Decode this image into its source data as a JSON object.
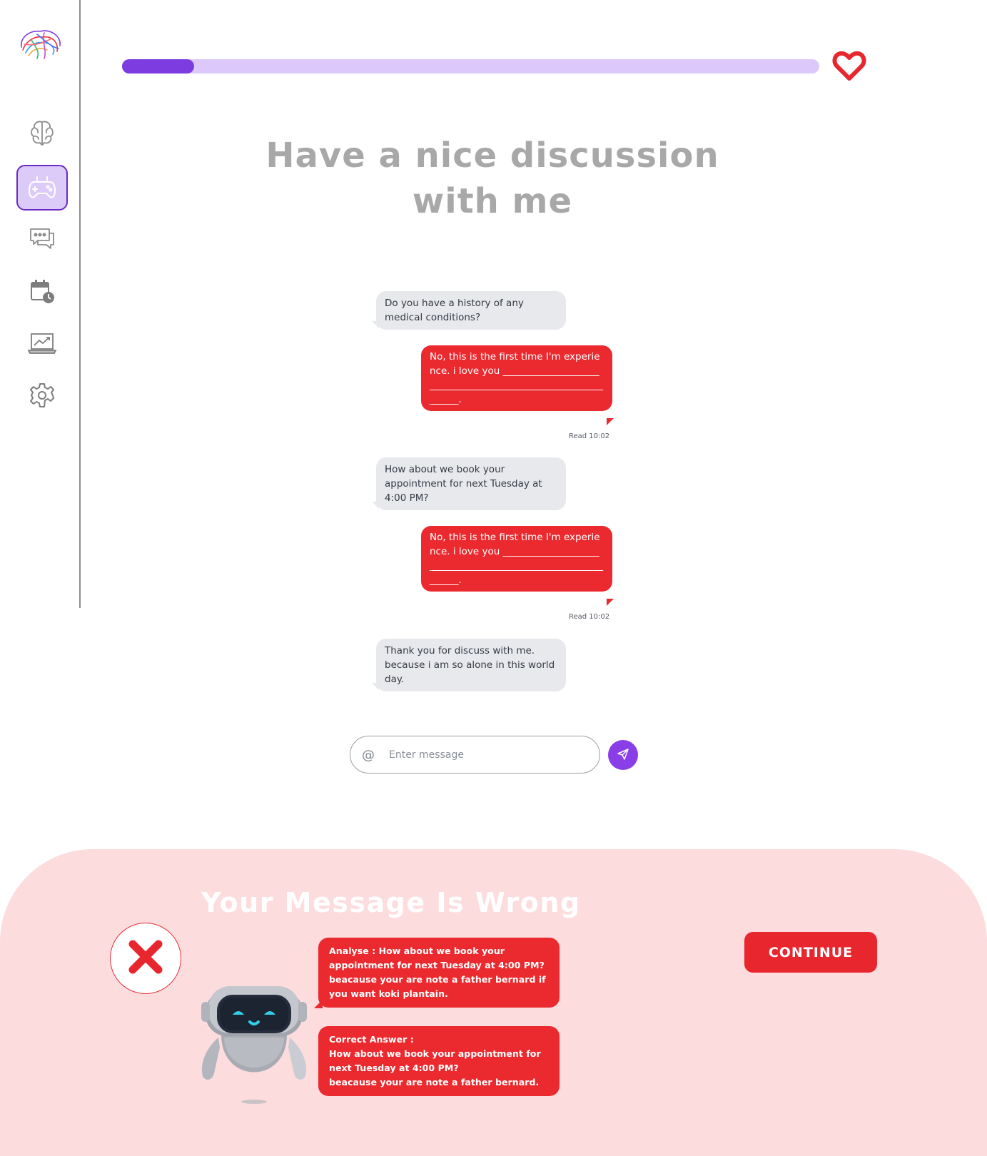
{
  "header": {
    "progress_fraction": 0.103,
    "title": "Have a nice discussion with me"
  },
  "sidebar": {
    "items": [
      {
        "name": "brain-icon",
        "active": false
      },
      {
        "name": "gamepad-icon",
        "active": true
      },
      {
        "name": "chat-icon",
        "active": false
      },
      {
        "name": "calendar-clock-icon",
        "active": false
      },
      {
        "name": "chart-monitor-icon",
        "active": false
      },
      {
        "name": "gear-icon",
        "active": false
      }
    ]
  },
  "chat": {
    "messages": [
      {
        "from": "bot",
        "text": "Do you have a history of any medical conditions?"
      },
      {
        "from": "user",
        "text": "No, this is the first time I'm experience. i love you ______________________________________________________________.",
        "meta": "Read 10:02"
      },
      {
        "from": "bot",
        "text": "How about we book your appointment for next Tuesday at 4:00 PM?"
      },
      {
        "from": "user",
        "text": "No, this is the first time I'm experience. i love you ______________________________________________________________.",
        "meta": "Read 10:02"
      },
      {
        "from": "bot",
        "text": "Thank you for discuss with me. because i am so alone in this world day."
      }
    ],
    "input": {
      "placeholder": "Enter message",
      "value": ""
    }
  },
  "feedback": {
    "title": "Your  Message Is Wrong",
    "analyse": "Analyse : How about we book your appointment for next Tuesday at 4:00 PM?\nbeacause your are note a father bernard if you want  koki plantain.",
    "correct": "Correct Answer :\nHow about we book your appointment for next Tuesday at 4:00 PM?\nbeacause your are note a father bernard.",
    "continue_label": "CONTINUE"
  },
  "colors": {
    "accent_purple": "#7c3ce0",
    "error_red": "#ea2a2f",
    "panel_pink": "#fddcde"
  }
}
